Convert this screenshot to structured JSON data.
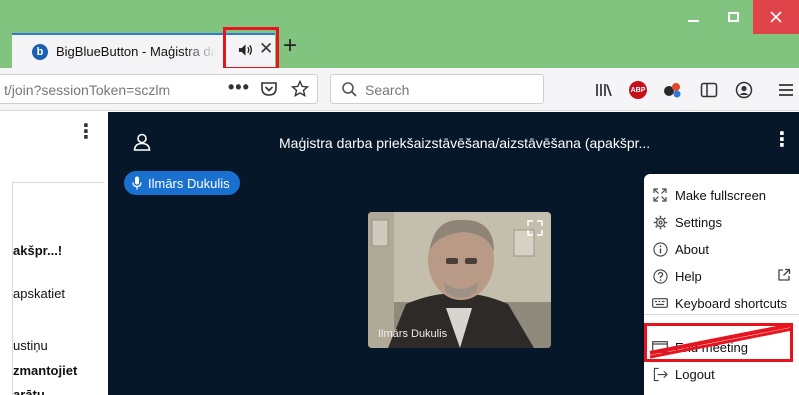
{
  "browser": {
    "tab_title": "BigBlueButton - Maģistra da",
    "tab_logo": "b",
    "url": "t/join?sessionToken=sczlm",
    "url_more": "•••",
    "search_placeholder": "Search",
    "abp_label": "ABP",
    "accent": "#80c480"
  },
  "left_panel": {
    "lines": [
      "akšpr...!",
      "apskatiet",
      "ustiņu",
      "zmantojiet",
      "arātu"
    ]
  },
  "meeting": {
    "title": "Maģistra darba priekšaizstāvēšana/aizstāvēšana (apakšpr...",
    "talker": "Ilmārs Dukulis",
    "video_name": "Ilmārs Dukulis",
    "background": "#06172a",
    "accent": "#1a70ce"
  },
  "menu": {
    "fullscreen": "Make fullscreen",
    "settings": "Settings",
    "about": "About",
    "help": "Help",
    "shortcuts": "Keyboard shortcuts",
    "end_meeting": "End meeting",
    "logout": "Logout"
  },
  "annotation_color": "#e8141d"
}
